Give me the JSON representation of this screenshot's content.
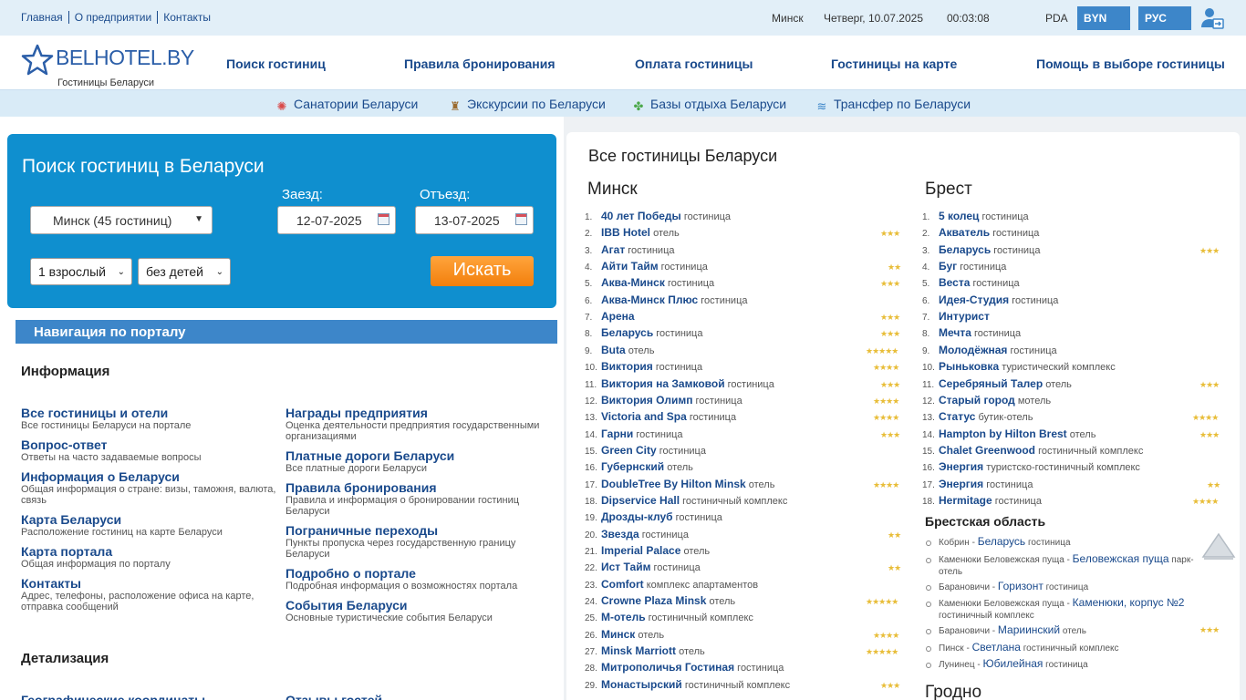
{
  "topbar": {
    "links": [
      "Главная",
      "О предприятии",
      "Контакты"
    ],
    "city": "Минск",
    "date": "Четверг, 10.07.2025",
    "time": "00:03:08",
    "pda": "PDA",
    "currency": "BYN",
    "language": "РУС"
  },
  "header": {
    "logo_text": "BELHOTEL.BY",
    "logo_sub": "Гостиницы Беларуси",
    "nav": [
      "Поиск гостиниц",
      "Правила бронирования",
      "Оплата гостиницы",
      "Гостиницы на карте",
      "Помощь в выборе гостиницы"
    ]
  },
  "subnav": [
    {
      "label": "Санатории Беларуси",
      "icon": "sun-icon",
      "color": "#d94a4a"
    },
    {
      "label": "Экскурсии по Беларуси",
      "icon": "tower-icon",
      "color": "#9b6b2f"
    },
    {
      "label": "Базы отдыха Беларуси",
      "icon": "clover-icon",
      "color": "#4aa84a"
    },
    {
      "label": "Трансфер по Беларуси",
      "icon": "wind-icon",
      "color": "#3d86c9"
    }
  ],
  "search": {
    "title": "Поиск гостиниц в Беларуси",
    "city_value": "Минск (45 гостиниц)",
    "checkin_label": "Заезд:",
    "checkin_value": "12-07-2025",
    "checkout_label": "Отъезд:",
    "checkout_value": "13-07-2025",
    "adults": "1 взрослый",
    "children": "без детей",
    "button": "Искать"
  },
  "portal_nav": {
    "title": "Навигация по порталу",
    "section_info": "Информация",
    "section_detail": "Детализация",
    "left": [
      {
        "title": "Все гостиницы и отели",
        "desc": "Все гостиницы Беларуси на портале"
      },
      {
        "title": "Вопрос-ответ",
        "desc": "Ответы на часто задаваемые вопросы"
      },
      {
        "title": "Информация о Беларуси",
        "desc": "Общая информация о стране: визы, таможня, валюта, связь"
      },
      {
        "title": "Карта Беларуси",
        "desc": "Расположение гостиниц на карте Беларуси"
      },
      {
        "title": "Карта портала",
        "desc": "Общая информация по порталу"
      },
      {
        "title": "Контакты",
        "desc": "Адрес, телефоны, расположение офиса на карте, отправка сообщений"
      }
    ],
    "right": [
      {
        "title": "Награды предприятия",
        "desc": "Оценка деятельности предприятия государственными организациями"
      },
      {
        "title": "Платные дороги Беларуси",
        "desc": "Все платные дороги Беларуси"
      },
      {
        "title": "Правила бронирования",
        "desc": "Правила и информация о бронировании гостиниц Беларуси"
      },
      {
        "title": "Пограничные переходы",
        "desc": "Пункты пропуска через государственную границу Беларуси"
      },
      {
        "title": "Подробно о портале",
        "desc": "Подробная информация о возможностях портала"
      },
      {
        "title": "События Беларуси",
        "desc": "Основные туристические события Беларуси"
      }
    ],
    "detail_left": "Географические координаты",
    "detail_right": "Отзывы гостей"
  },
  "all_hotels": {
    "title": "Все гостиницы Беларуси",
    "minsk_title": "Минск",
    "minsk": [
      {
        "n": "1.",
        "name": "40 лет Победы",
        "type": "гостиница",
        "stars": 0
      },
      {
        "n": "2.",
        "name": "IBB Hotel",
        "type": "отель",
        "stars": 3
      },
      {
        "n": "3.",
        "name": "Агат",
        "type": "гостиница",
        "stars": 0
      },
      {
        "n": "4.",
        "name": "Айти Тайм",
        "type": "гостиница",
        "stars": 2
      },
      {
        "n": "5.",
        "name": "Аква-Минск",
        "type": "гостиница",
        "stars": 3
      },
      {
        "n": "6.",
        "name": "Аква-Минск Плюс",
        "type": "гостиница",
        "stars": 0
      },
      {
        "n": "7.",
        "name": "Арена",
        "type": "",
        "stars": 3
      },
      {
        "n": "8.",
        "name": "Беларусь",
        "type": "гостиница",
        "stars": 3
      },
      {
        "n": "9.",
        "name": "Buta",
        "type": "отель",
        "stars": 5
      },
      {
        "n": "10.",
        "name": "Виктория",
        "type": "гостиница",
        "stars": 4
      },
      {
        "n": "11.",
        "name": "Виктория на Замковой",
        "type": "гостиница",
        "stars": 3
      },
      {
        "n": "12.",
        "name": "Виктория Олимп",
        "type": "гостиница",
        "stars": 4
      },
      {
        "n": "13.",
        "name": "Victoria and Spa",
        "type": "гостиница",
        "stars": 4
      },
      {
        "n": "14.",
        "name": "Гарни",
        "type": "гостиница",
        "stars": 3
      },
      {
        "n": "15.",
        "name": "Green City",
        "type": "гостиница",
        "stars": 0
      },
      {
        "n": "16.",
        "name": "Губернский",
        "type": "отель",
        "stars": 0
      },
      {
        "n": "17.",
        "name": "DoubleTree By Hilton Minsk",
        "type": "отель",
        "stars": 4
      },
      {
        "n": "18.",
        "name": "Dipservice Hall",
        "type": "гостиничный комплекс",
        "stars": 0
      },
      {
        "n": "19.",
        "name": "Дрозды-клуб",
        "type": "гостиница",
        "stars": 0
      },
      {
        "n": "20.",
        "name": "Звезда",
        "type": "гостиница",
        "stars": 2
      },
      {
        "n": "21.",
        "name": "Imperial Palace",
        "type": "отель",
        "stars": 0
      },
      {
        "n": "22.",
        "name": "Ист Тайм",
        "type": "гостиница",
        "stars": 2
      },
      {
        "n": "23.",
        "name": "Comfort",
        "type": "комплекс апартаментов",
        "stars": 0
      },
      {
        "n": "24.",
        "name": "Crowne Plaza Minsk",
        "type": "отель",
        "stars": 5
      },
      {
        "n": "25.",
        "name": "М-отель",
        "type": "гостиничный комплекс",
        "stars": 0
      },
      {
        "n": "26.",
        "name": "Минск",
        "type": "отель",
        "stars": 4
      },
      {
        "n": "27.",
        "name": "Minsk Marriott",
        "type": "отель",
        "stars": 5
      },
      {
        "n": "28.",
        "name": "Митрополичья Гостиная",
        "type": "гостиница",
        "stars": 0
      },
      {
        "n": "29.",
        "name": "Монастырский",
        "type": "гостиничный комплекс",
        "stars": 3
      }
    ],
    "brest_title": "Брест",
    "brest": [
      {
        "n": "1.",
        "name": "5 колец",
        "type": "гостиница",
        "stars": 0
      },
      {
        "n": "2.",
        "name": "Акватель",
        "type": "гостиница",
        "stars": 0
      },
      {
        "n": "3.",
        "name": "Беларусь",
        "type": "гостиница",
        "stars": 3
      },
      {
        "n": "4.",
        "name": "Буг",
        "type": "гостиница",
        "stars": 0
      },
      {
        "n": "5.",
        "name": "Веста",
        "type": "гостиница",
        "stars": 0
      },
      {
        "n": "6.",
        "name": "Идея-Студия",
        "type": "гостиница",
        "stars": 0
      },
      {
        "n": "7.",
        "name": "Интурист",
        "type": "",
        "stars": 0
      },
      {
        "n": "8.",
        "name": "Мечта",
        "type": "гостиница",
        "stars": 0
      },
      {
        "n": "9.",
        "name": "Молодёжная",
        "type": "гостиница",
        "stars": 0
      },
      {
        "n": "10.",
        "name": "Рыньковка",
        "type": "туристический комплекс",
        "stars": 0
      },
      {
        "n": "11.",
        "name": "Серебряный Талер",
        "type": "отель",
        "stars": 3
      },
      {
        "n": "12.",
        "name": "Старый город",
        "type": "мотель",
        "stars": 0
      },
      {
        "n": "13.",
        "name": "Статус",
        "type": "бутик-отель",
        "stars": 4
      },
      {
        "n": "14.",
        "name": "Hampton by Hilton Brest",
        "type": "отель",
        "stars": 3
      },
      {
        "n": "15.",
        "name": "Chalet Greenwood",
        "type": "гостиничный комплекс",
        "stars": 0
      },
      {
        "n": "16.",
        "name": "Энергия",
        "type": "туристско-гостиничный комплекс",
        "stars": 0
      },
      {
        "n": "17.",
        "name": "Энергия",
        "type": "гостиница",
        "stars": 2
      },
      {
        "n": "18.",
        "name": "Hermitage",
        "type": "гостиница",
        "stars": 4
      }
    ],
    "brest_region_title": "Брестская область",
    "brest_region": [
      {
        "place": "Кобрин",
        "name": "Беларусь",
        "type": "гостиница",
        "stars": 0,
        "lines": 1
      },
      {
        "place": "Каменюки Беловежская пуща",
        "name": "Беловежская пуща",
        "type": "парк-отель",
        "stars": 0,
        "lines": 2
      },
      {
        "place": "Барановичи",
        "name": "Горизонт",
        "type": "гостиница",
        "stars": 0,
        "lines": 1
      },
      {
        "place": "Каменюки Беловежская пуща",
        "name": "Каменюки, корпус №2",
        "type": "гостиничный комплекс",
        "stars": 0,
        "lines": 2
      },
      {
        "place": "Барановичи",
        "name": "Мариинский",
        "type": "отель",
        "stars": 3,
        "lines": 1
      },
      {
        "place": "Пинск",
        "name": "Светлана",
        "type": "гостиничный комплекс",
        "stars": 0,
        "lines": 1
      },
      {
        "place": "Лунинец",
        "name": "Юбилейная",
        "type": "гостиница",
        "stars": 0,
        "lines": 1
      }
    ],
    "grodno_title": "Гродно"
  }
}
